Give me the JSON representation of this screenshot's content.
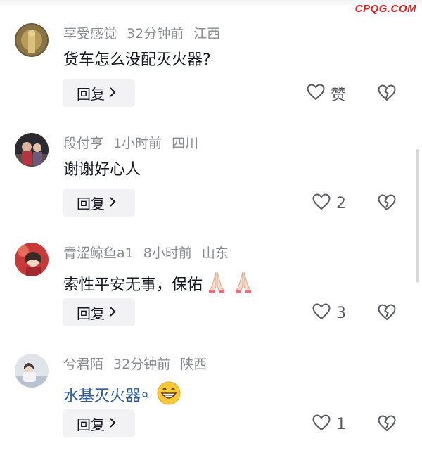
{
  "watermark": "CPQG.COM",
  "reply_label": "回复",
  "comments": [
    {
      "username": "享受感觉",
      "time": "32分钟前",
      "location": "江西",
      "text": "货车怎么没配灭火器?",
      "likes": "赞"
    },
    {
      "username": "段付亨",
      "time": "1小时前",
      "location": "四川",
      "text": "谢谢好心人",
      "likes": "2"
    },
    {
      "username": "青涩鲸鱼a1",
      "time": "8小时前",
      "location": "山东",
      "text": "索性平安无事，保佑",
      "likes": "3"
    },
    {
      "username": "兮君陌",
      "time": "32分钟前",
      "location": "陕西",
      "text": "水基灭火器",
      "likes": "1"
    }
  ],
  "colors": {
    "meta": "#8a8b91",
    "text": "#161823",
    "link": "#2b5d9c",
    "watermark": "#e02020"
  }
}
